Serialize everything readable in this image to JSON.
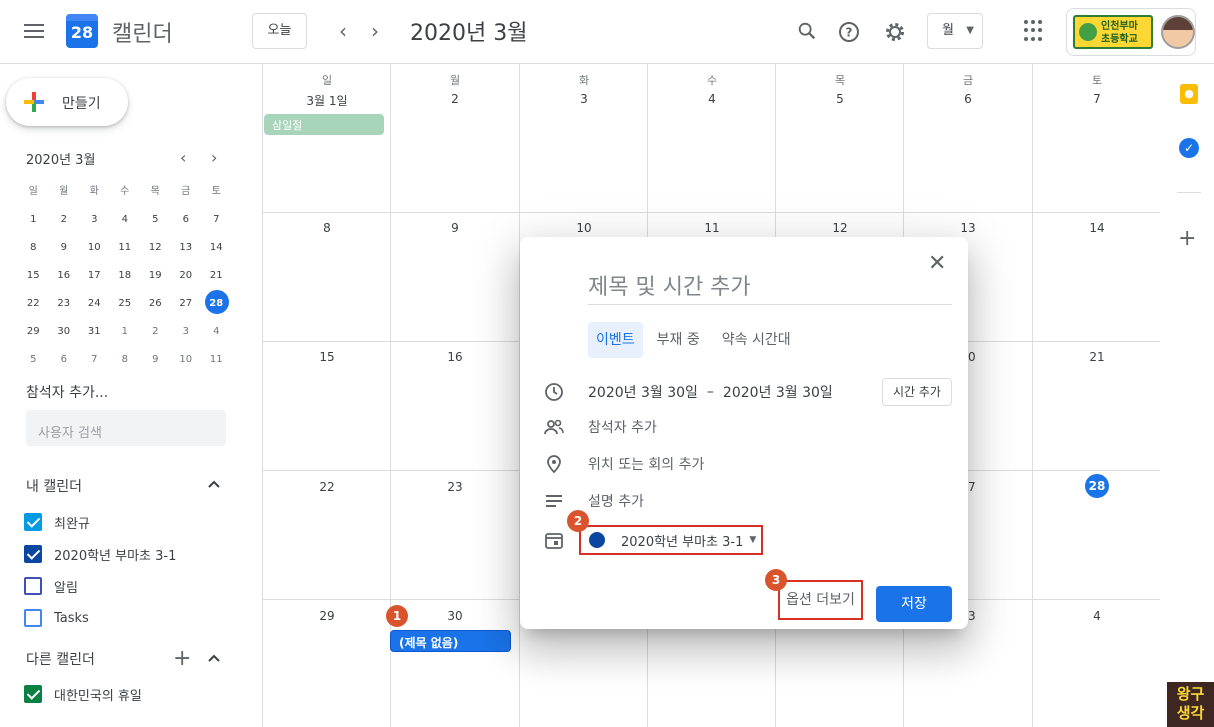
{
  "header": {
    "app_name": "캘린더",
    "logo_day": "28",
    "today_label": "오늘",
    "prev": "‹",
    "next": "›",
    "month_title": "2020년 3월",
    "view_label": "월",
    "school_line1": "인천부마",
    "school_line2": "초등학교",
    "icons": [
      "menu-icon",
      "search-icon",
      "help-icon",
      "settings-icon",
      "apps-icon"
    ]
  },
  "sidebar": {
    "create_label": "만들기",
    "mini_title": "2020년 3월",
    "weekdays": [
      "일",
      "월",
      "화",
      "수",
      "목",
      "금",
      "토"
    ],
    "weeks": [
      [
        "1",
        "2",
        "3",
        "4",
        "5",
        "6",
        "7"
      ],
      [
        "8",
        "9",
        "10",
        "11",
        "12",
        "13",
        "14"
      ],
      [
        "15",
        "16",
        "17",
        "18",
        "19",
        "20",
        "21"
      ],
      [
        "22",
        "23",
        "24",
        "25",
        "26",
        "27",
        "28"
      ],
      [
        "29",
        "30",
        "31",
        "1",
        "2",
        "3",
        "4"
      ],
      [
        "5",
        "6",
        "7",
        "8",
        "9",
        "10",
        "11"
      ]
    ],
    "attendee_label": "참석자 추가...",
    "user_search_placeholder": "사용자 검색",
    "my_calendars_label": "내 캘린더",
    "my_calendars": [
      {
        "name": "최완규",
        "color": "#039be5",
        "checked": true
      },
      {
        "name": "2020학년 부마초 3-1",
        "color": "#0b47a1",
        "checked": true
      },
      {
        "name": "알림",
        "color": "#3f51b5",
        "checked": false
      },
      {
        "name": "Tasks",
        "color": "#4285f4",
        "checked": false
      }
    ],
    "other_calendars_label": "다른 캘린더",
    "other_calendars": [
      {
        "name": "대한민국의 휴일",
        "color": "#0b8043",
        "checked": true
      }
    ]
  },
  "grid": {
    "weekdays": [
      "일",
      "월",
      "화",
      "수",
      "목",
      "금",
      "토"
    ],
    "first_label": "3월 1일",
    "week1": [
      "2",
      "3",
      "4",
      "5",
      "6",
      "7"
    ],
    "week2": [
      "8",
      "9",
      "10",
      "11",
      "12",
      "13",
      "14"
    ],
    "week3": [
      "15",
      "16",
      "",
      "",
      "",
      "",
      "21"
    ],
    "week4": [
      "22",
      "23",
      "",
      "",
      "",
      "",
      "28"
    ],
    "week5": [
      "29",
      "30",
      "",
      "",
      "",
      "",
      "4"
    ],
    "partial_nums": {
      "w3_fri": "0",
      "w4_fri": "7",
      "w5_fri": "3"
    },
    "holiday": "삼일절",
    "event": "(제목 없음)"
  },
  "dialog": {
    "title_placeholder": "제목 및 시간 추가",
    "tabs": [
      "이벤트",
      "부재 중",
      "약속 시간대"
    ],
    "date_start": "2020년 3월 30일",
    "date_sep": "–",
    "date_end": "2020년 3월 30일",
    "time_add": "시간 추가",
    "guests": "참석자 추가",
    "location": "위치 또는 회의 추가",
    "description": "설명 추가",
    "calendar": "2020학년 부마초 3-1",
    "more_options": "옵션 더보기",
    "save": "저장"
  },
  "markers": [
    "1",
    "2",
    "3"
  ],
  "right_panel": {
    "add": "+"
  },
  "watermark": {
    "line1": "왕구",
    "line2": "생각"
  },
  "colors": {
    "accent": "#1a73e8",
    "holiday": "#a8d5ba",
    "marker": "#d9542c",
    "highlight": "#d93025"
  }
}
